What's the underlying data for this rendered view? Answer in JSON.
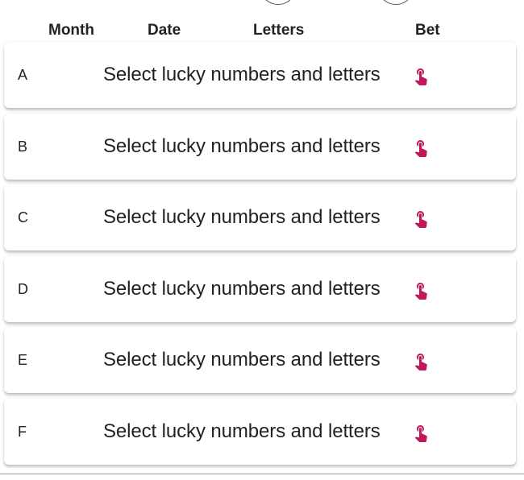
{
  "header": {
    "month": "Month",
    "date": "Date",
    "letters": "Letters",
    "bet": "Bet"
  },
  "rows": [
    {
      "letter": "A",
      "text": "Select lucky numbers and letters",
      "icon": "tap-hand-icon"
    },
    {
      "letter": "B",
      "text": "Select lucky numbers and letters",
      "icon": "tap-hand-icon"
    },
    {
      "letter": "C",
      "text": "Select lucky numbers and letters",
      "icon": "tap-hand-icon"
    },
    {
      "letter": "D",
      "text": "Select lucky numbers and letters",
      "icon": "tap-hand-icon"
    },
    {
      "letter": "E",
      "text": "Select lucky numbers and letters",
      "icon": "tap-hand-icon"
    },
    {
      "letter": "F",
      "text": "Select lucky numbers and letters",
      "icon": "tap-hand-icon"
    }
  ],
  "colors": {
    "accent": "#c2185b",
    "text": "#222222"
  }
}
